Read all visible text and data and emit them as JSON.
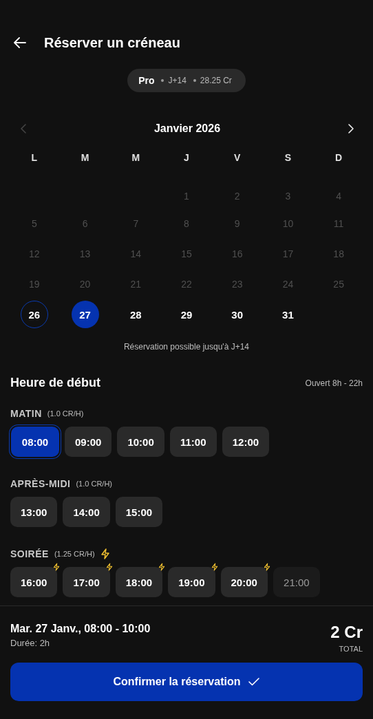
{
  "header": {
    "title": "Réserver un créneau"
  },
  "plan_chip": {
    "name": "Pro",
    "details": [
      "J+14",
      "28.25 Cr"
    ]
  },
  "calendar": {
    "month": "Janvier 2026",
    "prev_disabled": true,
    "next_disabled": false,
    "weekdays": [
      "L",
      "M",
      "M",
      "J",
      "V",
      "S",
      "D"
    ],
    "weeks": [
      [
        {
          "day": "1",
          "disabled": true,
          "today": false,
          "selected": false
        },
        {
          "day": "2",
          "disabled": true,
          "today": false,
          "selected": false
        },
        {
          "day": "3",
          "disabled": true,
          "today": false,
          "selected": false
        },
        {
          "day": "4",
          "disabled": true,
          "today": false,
          "selected": false
        }
      ],
      [
        {
          "day": "5",
          "disabled": true,
          "today": false,
          "selected": false
        },
        {
          "day": "6",
          "disabled": true,
          "today": false,
          "selected": false
        },
        {
          "day": "7",
          "disabled": true,
          "today": false,
          "selected": false
        },
        {
          "day": "8",
          "disabled": true,
          "today": false,
          "selected": false
        },
        {
          "day": "9",
          "disabled": true,
          "today": false,
          "selected": false
        },
        {
          "day": "10",
          "disabled": true,
          "today": false,
          "selected": false
        },
        {
          "day": "11",
          "disabled": true,
          "today": false,
          "selected": false
        }
      ],
      [
        {
          "day": "12",
          "disabled": true,
          "today": false,
          "selected": false
        },
        {
          "day": "13",
          "disabled": true,
          "today": false,
          "selected": false
        },
        {
          "day": "14",
          "disabled": true,
          "today": false,
          "selected": false
        },
        {
          "day": "15",
          "disabled": true,
          "today": false,
          "selected": false
        },
        {
          "day": "16",
          "disabled": true,
          "today": false,
          "selected": false
        },
        {
          "day": "17",
          "disabled": true,
          "today": false,
          "selected": false
        },
        {
          "day": "18",
          "disabled": true,
          "today": false,
          "selected": false
        }
      ],
      [
        {
          "day": "19",
          "disabled": true,
          "today": false,
          "selected": false
        },
        {
          "day": "20",
          "disabled": true,
          "today": false,
          "selected": false
        },
        {
          "day": "21",
          "disabled": true,
          "today": false,
          "selected": false
        },
        {
          "day": "22",
          "disabled": true,
          "today": false,
          "selected": false
        },
        {
          "day": "23",
          "disabled": true,
          "today": false,
          "selected": false
        },
        {
          "day": "24",
          "disabled": true,
          "today": false,
          "selected": false
        },
        {
          "day": "25",
          "disabled": true,
          "today": false,
          "selected": false
        }
      ],
      [
        {
          "day": "26",
          "disabled": false,
          "today": true,
          "selected": false
        },
        {
          "day": "27",
          "disabled": false,
          "today": false,
          "selected": true
        },
        {
          "day": "28",
          "disabled": false,
          "today": false,
          "selected": false
        },
        {
          "day": "29",
          "disabled": false,
          "today": false,
          "selected": false
        },
        {
          "day": "30",
          "disabled": false,
          "today": false,
          "selected": false
        },
        {
          "day": "31",
          "disabled": false,
          "today": false,
          "selected": false
        }
      ]
    ],
    "hint": "Réservation possible jusqu'à J+14"
  },
  "start_time": {
    "title": "Heure de début",
    "hours": "Ouvert 8h - 22h",
    "periods": [
      {
        "name": "MATIN",
        "rate": "(1.0 CR/H)",
        "peak": false,
        "slots": [
          {
            "time": "08:00",
            "selected": true,
            "disabled": false,
            "peak": false
          },
          {
            "time": "09:00",
            "selected": false,
            "disabled": false,
            "peak": false
          },
          {
            "time": "10:00",
            "selected": false,
            "disabled": false,
            "peak": false
          },
          {
            "time": "11:00",
            "selected": false,
            "disabled": false,
            "peak": false
          },
          {
            "time": "12:00",
            "selected": false,
            "disabled": false,
            "peak": false
          }
        ]
      },
      {
        "name": "APRÈS-MIDI",
        "rate": "(1.0 CR/H)",
        "peak": false,
        "slots": [
          {
            "time": "13:00",
            "selected": false,
            "disabled": false,
            "peak": false
          },
          {
            "time": "14:00",
            "selected": false,
            "disabled": false,
            "peak": false
          },
          {
            "time": "15:00",
            "selected": false,
            "disabled": false,
            "peak": false
          }
        ]
      },
      {
        "name": "SOIRÉE",
        "rate": "(1.25 CR/H)",
        "peak": true,
        "slots": [
          {
            "time": "16:00",
            "selected": false,
            "disabled": false,
            "peak": true
          },
          {
            "time": "17:00",
            "selected": false,
            "disabled": false,
            "peak": true
          },
          {
            "time": "18:00",
            "selected": false,
            "disabled": false,
            "peak": true
          },
          {
            "time": "19:00",
            "selected": false,
            "disabled": false,
            "peak": true
          },
          {
            "time": "20:00",
            "selected": false,
            "disabled": false,
            "peak": true
          },
          {
            "time": "21:00",
            "selected": false,
            "disabled": true,
            "peak": false
          }
        ]
      }
    ]
  },
  "summary": {
    "slot": "Mar. 27 Janv., 08:00 - 10:00",
    "duration": "Durée: 2h",
    "price": "2 Cr",
    "price_label": "TOTAL"
  },
  "confirm_button": {
    "label": "Confirmer la réservation"
  }
}
